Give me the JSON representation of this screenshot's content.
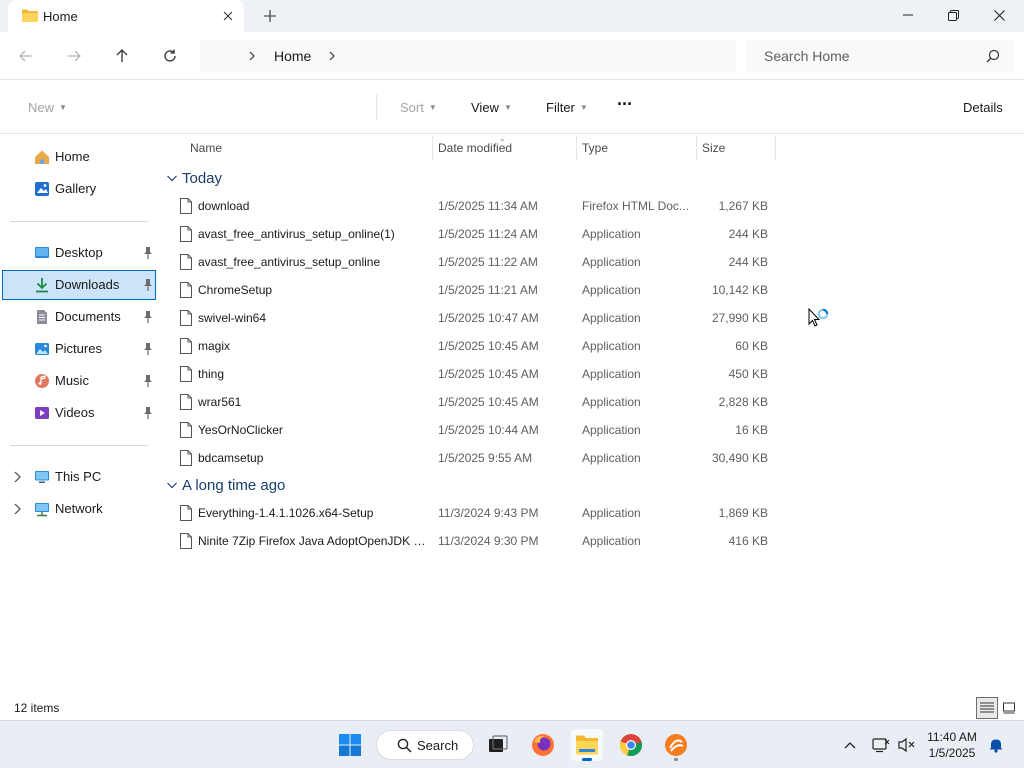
{
  "window": {
    "tab_title": "Home",
    "search_placeholder": "Search Home",
    "breadcrumb": [
      "Home"
    ]
  },
  "toolbar": {
    "new": "New",
    "sort": "Sort",
    "view": "View",
    "filter": "Filter",
    "more": "···",
    "details": "Details"
  },
  "sidebar": {
    "quick": [
      {
        "label": "Home",
        "icon": "home-icon"
      },
      {
        "label": "Gallery",
        "icon": "gallery-icon"
      }
    ],
    "pinned": [
      {
        "label": "Desktop",
        "icon": "desktop-icon"
      },
      {
        "label": "Downloads",
        "icon": "downloads-icon",
        "selected": true
      },
      {
        "label": "Documents",
        "icon": "documents-icon"
      },
      {
        "label": "Pictures",
        "icon": "pictures-icon"
      },
      {
        "label": "Music",
        "icon": "music-icon"
      },
      {
        "label": "Videos",
        "icon": "videos-icon"
      }
    ],
    "devices": [
      {
        "label": "This PC",
        "icon": "this-pc-icon"
      },
      {
        "label": "Network",
        "icon": "network-icon"
      }
    ]
  },
  "columns": {
    "name": "Name",
    "date": "Date modified",
    "type": "Type",
    "size": "Size"
  },
  "groups": [
    {
      "label": "Today",
      "files": [
        {
          "name": "download",
          "date": "1/5/2025 11:34 AM",
          "type": "Firefox HTML Doc...",
          "size": "1,267 KB"
        },
        {
          "name": "avast_free_antivirus_setup_online(1)",
          "date": "1/5/2025 11:24 AM",
          "type": "Application",
          "size": "244 KB"
        },
        {
          "name": "avast_free_antivirus_setup_online",
          "date": "1/5/2025 11:22 AM",
          "type": "Application",
          "size": "244 KB"
        },
        {
          "name": "ChromeSetup",
          "date": "1/5/2025 11:21 AM",
          "type": "Application",
          "size": "10,142 KB"
        },
        {
          "name": "swivel-win64",
          "date": "1/5/2025 10:47 AM",
          "type": "Application",
          "size": "27,990 KB"
        },
        {
          "name": "magix",
          "date": "1/5/2025 10:45 AM",
          "type": "Application",
          "size": "60 KB"
        },
        {
          "name": "thing",
          "date": "1/5/2025 10:45 AM",
          "type": "Application",
          "size": "450 KB"
        },
        {
          "name": "wrar561",
          "date": "1/5/2025 10:45 AM",
          "type": "Application",
          "size": "2,828 KB"
        },
        {
          "name": "YesOrNoClicker",
          "date": "1/5/2025 10:44 AM",
          "type": "Application",
          "size": "16 KB"
        },
        {
          "name": "bdcamsetup",
          "date": "1/5/2025 9:55 AM",
          "type": "Application",
          "size": "30,490 KB"
        }
      ]
    },
    {
      "label": "A long time ago",
      "files": [
        {
          "name": "Everything-1.4.1.1026.x64-Setup",
          "date": "11/3/2024 9:43 PM",
          "type": "Application",
          "size": "1,869 KB"
        },
        {
          "name": "Ninite 7Zip Firefox Java AdoptOpenJDK x...",
          "date": "11/3/2024 9:30 PM",
          "type": "Application",
          "size": "416 KB"
        }
      ]
    }
  ],
  "status": {
    "item_count": "12 items"
  },
  "taskbar": {
    "search_label": "Search",
    "time": "11:40 AM",
    "date": "1/5/2025"
  },
  "colors": {
    "accent": "#0067c0",
    "selected_bg": "#cce4f7",
    "group_label": "#1a3e6e"
  }
}
